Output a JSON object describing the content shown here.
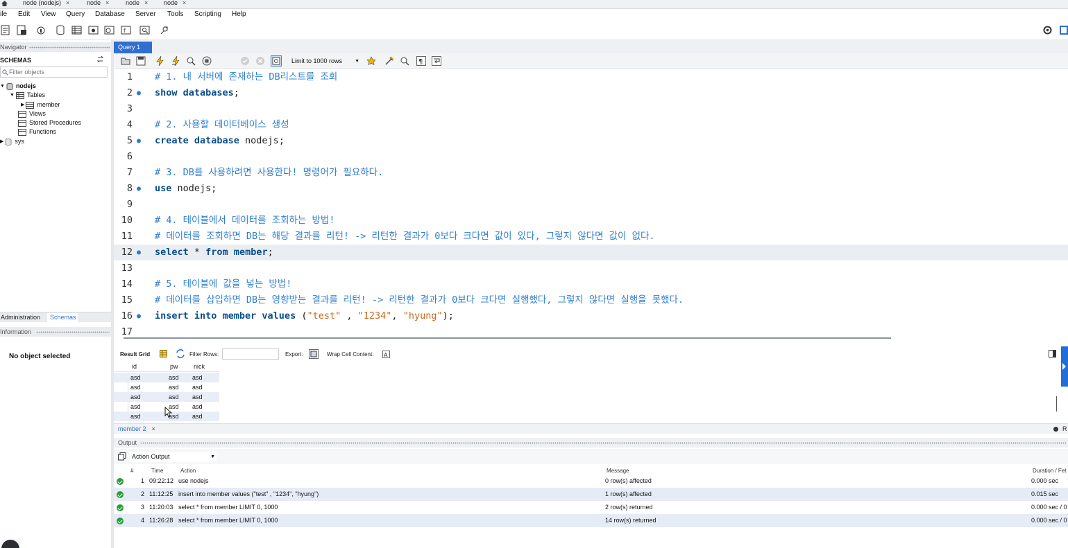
{
  "connection_tabs": [
    {
      "label": "node (nodejs)"
    },
    {
      "label": "node"
    },
    {
      "label": "node"
    },
    {
      "label": "node"
    }
  ],
  "tab_close": "×",
  "menu": {
    "file": "ile",
    "edit": "Edit",
    "view": "View",
    "query": "Query",
    "database": "Database",
    "server": "Server",
    "tools": "Tools",
    "scripting": "Scripting",
    "help": "Help"
  },
  "navigator": {
    "title": "Navigator",
    "schemas_label": "SCHEMAS",
    "filter_placeholder": "Filter objects",
    "tree": {
      "db": "nodejs",
      "tables": "Tables",
      "member": "member",
      "views": "Views",
      "stored_procedures": "Stored Procedures",
      "functions": "Functions",
      "sys": "sys"
    },
    "tabs": {
      "administration": "Administration",
      "schemas": "Schemas"
    }
  },
  "information": {
    "title": "Information",
    "empty": "No object selected"
  },
  "query_tab": {
    "label": "Query 1"
  },
  "editor_toolbar": {
    "limit": "Limit to 1000 rows"
  },
  "editor_lines": [
    {
      "n": "1",
      "marker": "",
      "text": "# 1. 내 서버에 존재하는 DB리스트를 조회",
      "kind": "comment"
    },
    {
      "n": "2",
      "marker": "●",
      "parts": [
        {
          "t": "show databases",
          "c": "kw"
        },
        {
          "t": ";",
          "c": ""
        }
      ]
    },
    {
      "n": "3",
      "marker": "",
      "text": "",
      "kind": ""
    },
    {
      "n": "4",
      "marker": "",
      "text": "# 2. 사용할 데이터베이스 생성",
      "kind": "comment"
    },
    {
      "n": "5",
      "marker": "●",
      "parts": [
        {
          "t": "create database ",
          "c": "kw"
        },
        {
          "t": "nodejs;",
          "c": ""
        }
      ]
    },
    {
      "n": "6",
      "marker": "",
      "text": "",
      "kind": ""
    },
    {
      "n": "7",
      "marker": "",
      "text": "# 3. DB를 사용하려면 사용한다! 명령어가 필요하다.",
      "kind": "comment"
    },
    {
      "n": "8",
      "marker": "●",
      "parts": [
        {
          "t": "use ",
          "c": "kw"
        },
        {
          "t": "nodejs;",
          "c": ""
        }
      ]
    },
    {
      "n": "9",
      "marker": "",
      "text": "",
      "kind": ""
    },
    {
      "n": "10",
      "marker": "",
      "text": "# 4. 테이블에서 데이터를 조회하는 방법!",
      "kind": "comment"
    },
    {
      "n": "11",
      "marker": "",
      "text": "# 데이터를 조회하면 DB는 해당 결과를 리턴! -> 리턴한 결과가 0보다 크다면 값이 있다, 그렇지 않다면 값이 없다.",
      "kind": "comment"
    },
    {
      "n": "12",
      "marker": "●",
      "active": true,
      "parts": [
        {
          "t": "select",
          "c": "kw"
        },
        {
          "t": " * ",
          "c": ""
        },
        {
          "t": "from member",
          "c": "kw"
        },
        {
          "t": ";",
          "c": ""
        }
      ]
    },
    {
      "n": "13",
      "marker": "",
      "text": "",
      "kind": ""
    },
    {
      "n": "14",
      "marker": "",
      "text": "# 5. 테이블에 값을 넣는 방법!",
      "kind": "comment"
    },
    {
      "n": "15",
      "marker": "",
      "text": "# 데이터를 삽입하면 DB는 영향받는 결과를 리턴! -> 리턴한 결과가 0보다 크다면 실행했다, 그렇지 않다면 실행을 못했다.",
      "kind": "comment"
    },
    {
      "n": "16",
      "marker": "●",
      "parts": [
        {
          "t": "insert into member values ",
          "c": "kw"
        },
        {
          "t": "(",
          "c": ""
        },
        {
          "t": "\"test\"",
          "c": "str"
        },
        {
          "t": " , ",
          "c": ""
        },
        {
          "t": "\"1234\"",
          "c": "str"
        },
        {
          "t": ", ",
          "c": ""
        },
        {
          "t": "\"hyung\"",
          "c": "str"
        },
        {
          "t": ");",
          "c": ""
        }
      ]
    },
    {
      "n": "17",
      "marker": "",
      "text": "",
      "kind": ""
    }
  ],
  "result_toolbar": {
    "result_grid": "Result Grid",
    "filter_rows": "Filter Rows:",
    "export": "Export:",
    "wrap": "Wrap Cell Content:"
  },
  "grid": {
    "columns": [
      "id",
      "pw",
      "nick"
    ],
    "rows": [
      [
        "asd",
        "asd",
        "asd"
      ],
      [
        "asd",
        "asd",
        "asd"
      ],
      [
        "asd",
        "asd",
        "asd"
      ],
      [
        "asd",
        "asd",
        "asd"
      ],
      [
        "asd",
        "asd",
        "asd"
      ]
    ]
  },
  "result_tab": {
    "label": "member 2",
    "close": "×",
    "right_label": "R"
  },
  "output": {
    "title": "Output",
    "selector": "Action Output",
    "columns": {
      "num": "#",
      "time": "Time",
      "action": "Action",
      "message": "Message",
      "duration": "Duration / Fet"
    },
    "rows": [
      {
        "num": "1",
        "time": "09:22:12",
        "action": "use nodejs",
        "message": "0 row(s) affected",
        "duration": "0.000 sec"
      },
      {
        "num": "2",
        "time": "11:12:25",
        "action": "insert into member values (\"test\" , \"1234\", \"hyung\")",
        "message": "1 row(s) affected",
        "duration": "0.015 sec"
      },
      {
        "num": "3",
        "time": "11:20:03",
        "action": "select * from member LIMIT 0, 1000",
        "message": "2 row(s) returned",
        "duration": "0.000 sec / 0"
      },
      {
        "num": "4",
        "time": "11:26:28",
        "action": "select * from member LIMIT 0, 1000",
        "message": "14 row(s) returned",
        "duration": "0.000 sec / 0"
      }
    ]
  },
  "colors": {
    "accent": "#2f6fd0",
    "comment": "#2f7fd0",
    "keyword": "#0a4e8c",
    "string": "#c9681a",
    "success": "#2a9d3a"
  },
  "icons": [
    "home-icon",
    "new-query-icon",
    "open-sql-icon",
    "inspector-icon",
    "schema-icon",
    "table-icon",
    "view-icon",
    "procedure-icon",
    "function-icon",
    "search-table-icon",
    "reconnect-icon",
    "settings-icon",
    "execute-icon",
    "execute-current-icon",
    "explain-icon",
    "stop-icon",
    "commit-icon",
    "rollback-icon",
    "autocommit-icon",
    "beautify-icon",
    "find-icon",
    "invisible-chars-icon",
    "wrap-icon",
    "success-icon",
    "cursor-icon"
  ]
}
